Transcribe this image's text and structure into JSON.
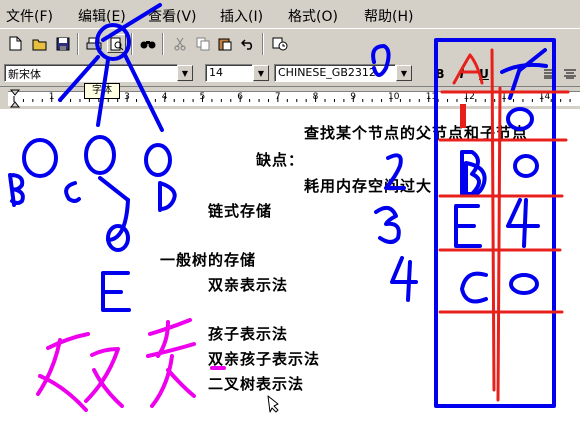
{
  "menu": {
    "items": [
      "文件(F)",
      "编辑(E)",
      "查看(V)",
      "插入(I)",
      "格式(O)",
      "帮助(H)"
    ]
  },
  "format_bar": {
    "font_name": "新宋体",
    "font_size": "14",
    "charset": "CHINESE_GB2312",
    "bold": "B",
    "italic": "I",
    "underline": "U"
  },
  "tooltip": "字体",
  "ruler": {
    "numbers": [
      "1",
      "2",
      "3",
      "4",
      "5",
      "6",
      "7",
      "8",
      "9",
      "10",
      "11",
      "12",
      "13",
      "14"
    ]
  },
  "document": {
    "lines": [
      "查找某个节点的父节点和子节点",
      "缺点：",
      "耗用内存空间过大",
      "链式存储",
      "一般树的存储",
      "双亲表示法",
      "孩子表示法",
      "双亲孩子表示法",
      "二叉树表示法"
    ]
  },
  "annotations": {
    "ink_blue": "#0000ee",
    "ink_red": "#e8201c",
    "ink_magenta": "#ee00ee",
    "tree_nodes": [
      "A",
      "B",
      "C",
      "D",
      "E"
    ],
    "table_rows": [
      {
        "index": "",
        "node": "A",
        "parent": "-1"
      },
      {
        "index": "1",
        "node": "B",
        "parent": "0"
      },
      {
        "index": "2",
        "node": "D",
        "parent": "0"
      },
      {
        "index": "3",
        "node": "E",
        "parent": "4"
      },
      {
        "index": "4",
        "node": "C",
        "parent": "0"
      }
    ],
    "handwriting": "双亲"
  }
}
